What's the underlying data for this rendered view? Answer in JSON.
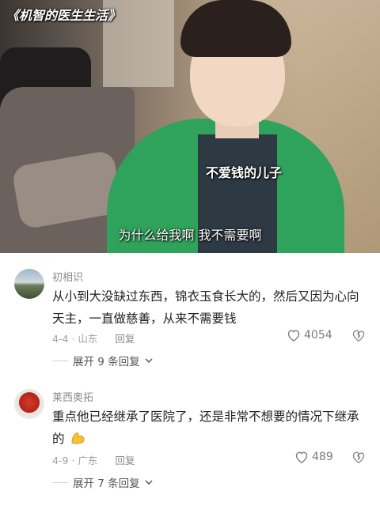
{
  "video": {
    "title": "《机智的医生生活》",
    "caption_top": "不爱钱的儿子",
    "caption_bottom": "为什么给我啊 我不需要啊"
  },
  "comments": [
    {
      "username": "初相识",
      "text": "从小到大没缺过东西，锦衣玉食长大的，然后又因为心向天主，一直做慈善，从来不需要钱",
      "date": "4-4",
      "location": "山东",
      "reply_label": "回复",
      "likes": "4054",
      "expand_label": "展开 9 条回复",
      "avatar_icon": "landscape-avatar"
    },
    {
      "username": "莱西奥拓",
      "text": "重点他已经继承了医院了，还是非常不想要的情况下继承的",
      "emoji_icon": "flexed-biceps-emoji",
      "date": "4-9",
      "location": "广东",
      "reply_label": "回复",
      "likes": "489",
      "expand_label": "展开 7 条回复",
      "avatar_icon": "red-avatar"
    }
  ],
  "colors": {
    "accent_green": "#2fa25b",
    "text": "#222222",
    "muted": "#a0a0a0"
  }
}
